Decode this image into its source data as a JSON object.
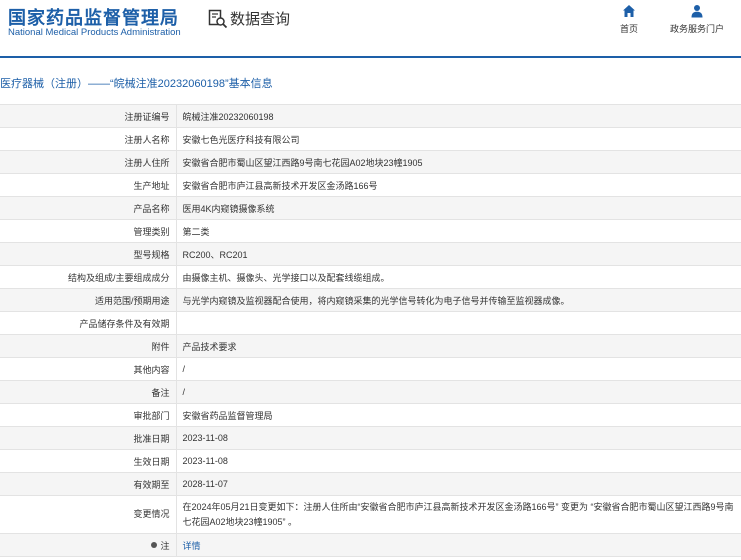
{
  "header": {
    "logo_cn": "国家药品监督管理局",
    "logo_en": "National Medical Products Administration",
    "search_label": "数据查询",
    "home_label": "首页",
    "service_label": "政务服务门户"
  },
  "title": "医疗器械（注册）——“皖械注准20232060198”基本信息",
  "rows": [
    {
      "k": "注册证编号",
      "v": "皖械注准20232060198"
    },
    {
      "k": "注册人名称",
      "v": "安徽七色光医疗科技有限公司"
    },
    {
      "k": "注册人住所",
      "v": "安徽省合肥市蜀山区望江西路9号南七花园A02地块23幢1905"
    },
    {
      "k": "生产地址",
      "v": "安徽省合肥市庐江县高新技术开发区金汤路166号"
    },
    {
      "k": "产品名称",
      "v": "医用4K内窥镜摄像系统"
    },
    {
      "k": "管理类别",
      "v": "第二类"
    },
    {
      "k": "型号规格",
      "v": "RC200、RC201"
    },
    {
      "k": "结构及组成/主要组成成分",
      "v": "由摄像主机、摄像头、光学接口以及配套线缆组成。"
    },
    {
      "k": "适用范围/预期用途",
      "v": "与光学内窥镜及监视器配合使用，将内窥镜采集的光学信号转化为电子信号并传输至监视器成像。"
    },
    {
      "k": "产品储存条件及有效期",
      "v": ""
    },
    {
      "k": "附件",
      "v": "产品技术要求"
    },
    {
      "k": "其他内容",
      "v": "/"
    },
    {
      "k": "备注",
      "v": "/"
    },
    {
      "k": "审批部门",
      "v": "安徽省药品监督管理局"
    },
    {
      "k": "批准日期",
      "v": "2023-11-08"
    },
    {
      "k": "生效日期",
      "v": "2023-11-08"
    },
    {
      "k": "有效期至",
      "v": "2028-11-07"
    },
    {
      "k": "变更情况",
      "v": "在2024年05月21日变更如下：注册人住所由“安徽省合肥市庐江县高新技术开发区金汤路166号” 变更为 “安徽省合肥市蜀山区望江西路9号南七花园A02地块23幢1905” 。"
    },
    {
      "k": "注",
      "v": "详情"
    }
  ],
  "colors": {
    "brand": "#1d5fa8"
  }
}
